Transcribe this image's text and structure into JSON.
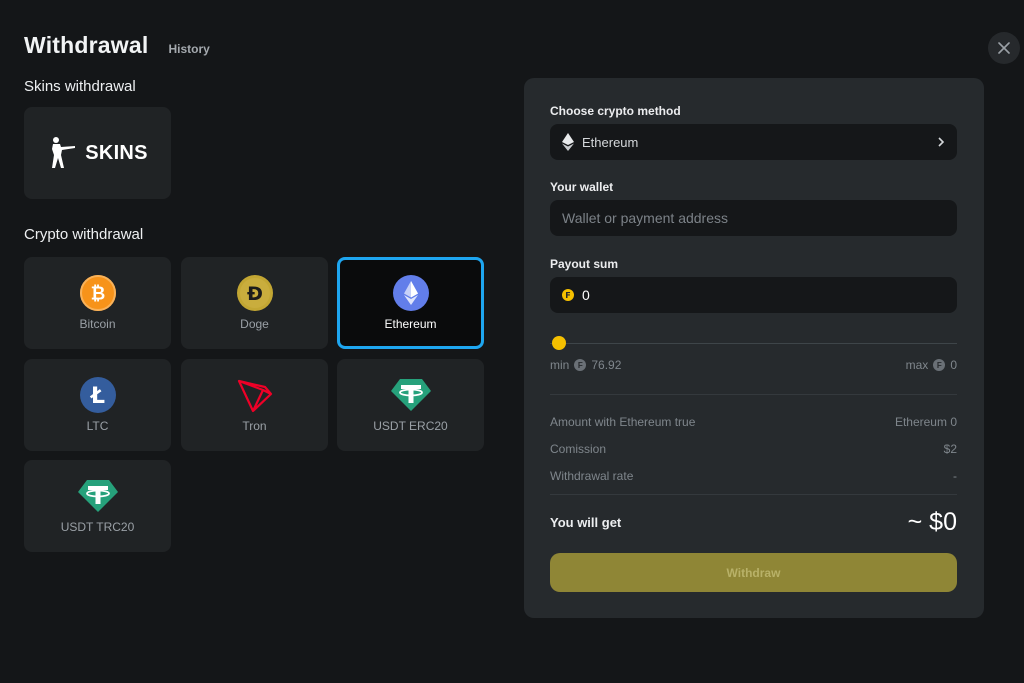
{
  "header": {
    "title": "Withdrawal",
    "history_label": "History"
  },
  "sections": {
    "skins_title": "Skins withdrawal",
    "crypto_title": "Crypto withdrawal"
  },
  "skins": {
    "label": "SKINS"
  },
  "methods": [
    {
      "label": "Bitcoin",
      "icon": "bitcoin-icon",
      "color": "#f7931a"
    },
    {
      "label": "Doge",
      "icon": "doge-icon",
      "color": "#c2a633"
    },
    {
      "label": "Ethereum",
      "icon": "ethereum-icon",
      "color": "#627eea"
    },
    {
      "label": "LTC",
      "icon": "litecoin-icon",
      "color": "#345d9d"
    },
    {
      "label": "Tron",
      "icon": "tron-icon",
      "color": "#ef0027"
    },
    {
      "label": "USDT ERC20",
      "icon": "tether-icon",
      "color": "#26a17b"
    },
    {
      "label": "USDT TRC20",
      "icon": "tether-icon",
      "color": "#26a17b"
    }
  ],
  "selected_method": "Ethereum",
  "panel": {
    "method_label": "Choose crypto method",
    "method_value": "Ethereum",
    "wallet_label": "Your wallet",
    "wallet_placeholder": "Wallet or payment address",
    "payout_label": "Payout sum",
    "payout_value": "0",
    "slider": {
      "min_label": "min",
      "min_value": "76.92",
      "max_label": "max",
      "max_value": "0",
      "level": 0
    },
    "rows": [
      {
        "label": "Amount with Ethereum true",
        "value": "Ethereum 0"
      },
      {
        "label": "Comission",
        "value": "$2"
      },
      {
        "label": "Withdrawal rate",
        "value": "-"
      }
    ],
    "get_label": "You will get",
    "get_value": "~ $0",
    "withdraw_label": "Withdraw"
  },
  "colors": {
    "accent": "#1ea6f0",
    "knob": "#f5c000",
    "button": "#8f8636"
  }
}
